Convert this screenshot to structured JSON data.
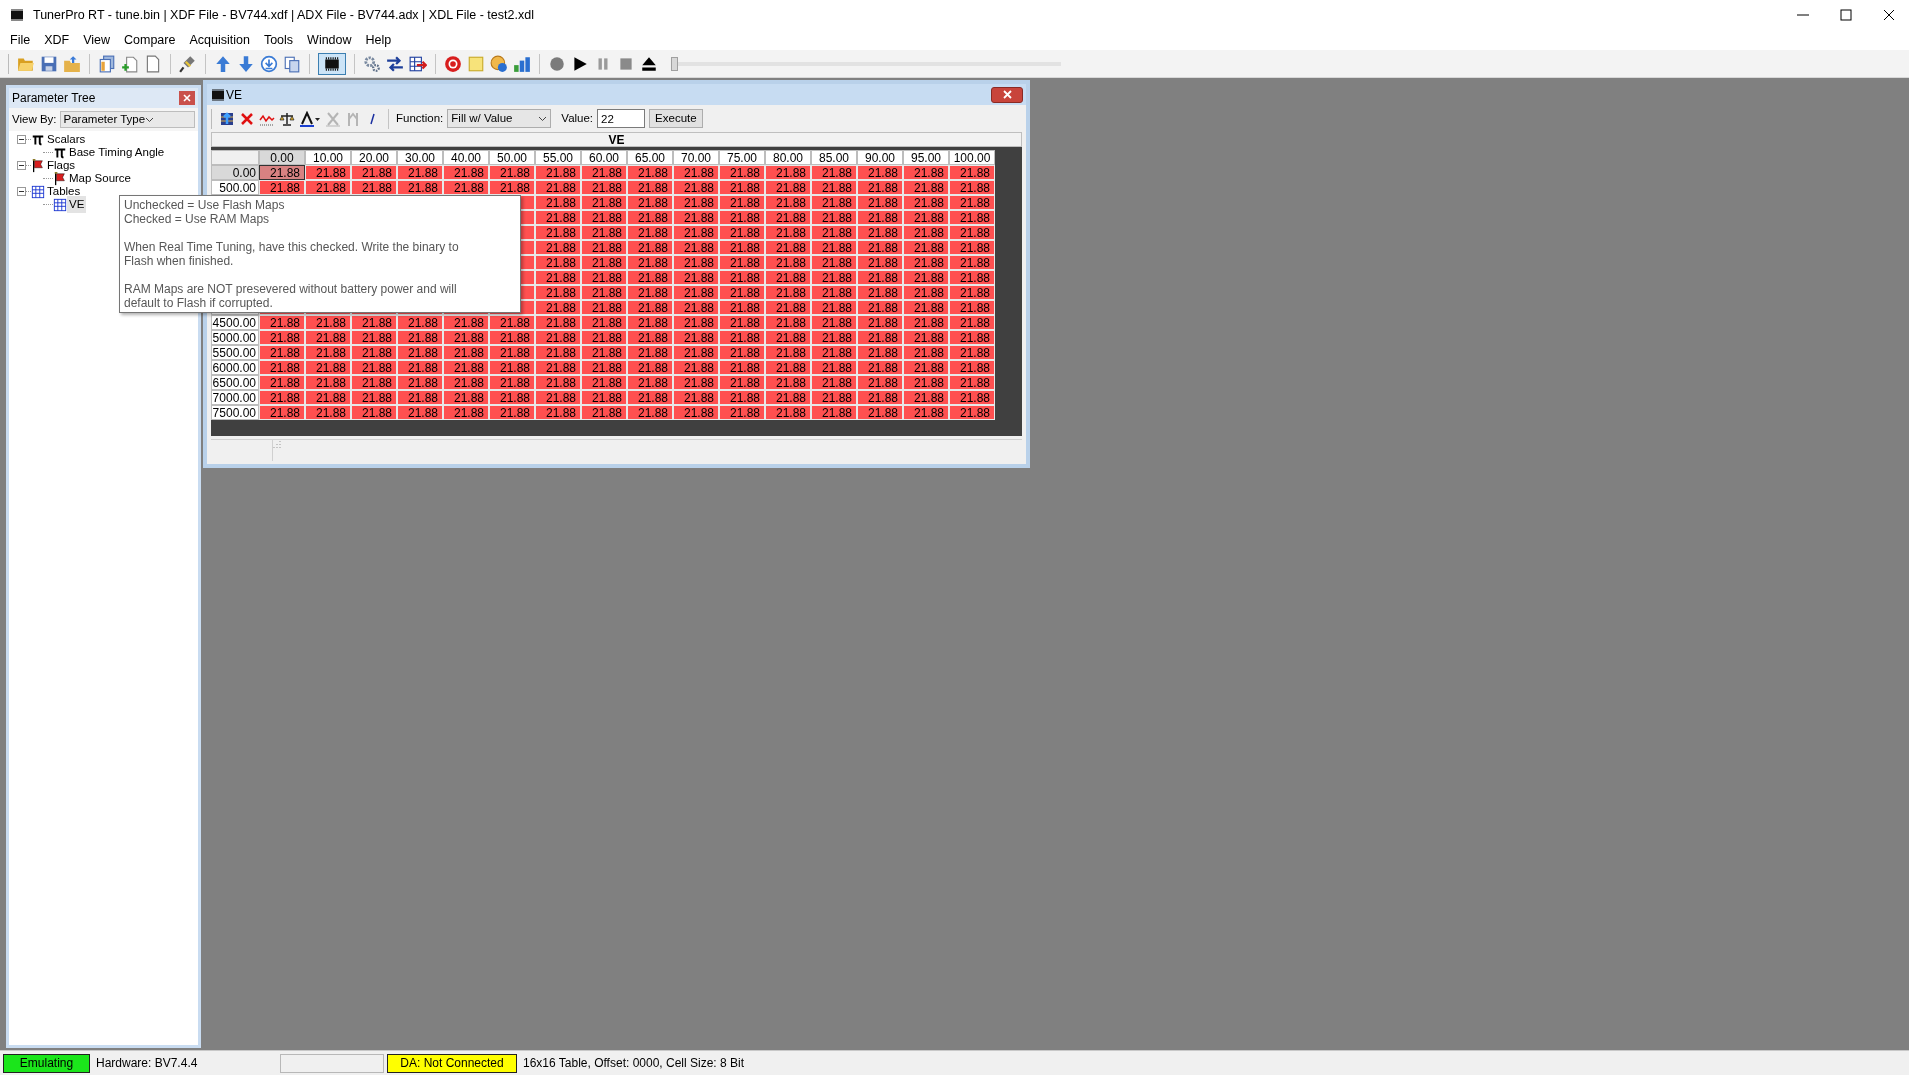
{
  "window": {
    "title": "TunerPro RT - tune.bin | XDF File - BV744.xdf | ADX File - BV744.adx | XDL File - test2.xdl"
  },
  "menu": [
    "File",
    "XDF",
    "View",
    "Compare",
    "Acquisition",
    "Tools",
    "Window",
    "Help"
  ],
  "toolbar": {
    "emulator_button": {
      "pressed": true
    },
    "playback_slider": {
      "level": 0
    }
  },
  "parameter_tree": {
    "title": "Parameter Tree",
    "view_by_label": "View By:",
    "view_by": "Parameter Type",
    "items": [
      {
        "label": "Scalars",
        "kind": "scalar",
        "expanded": true,
        "selected": false,
        "children": [
          {
            "label": "Base Timing Angle",
            "kind": "scalar",
            "selected": false
          }
        ]
      },
      {
        "label": "Flags",
        "kind": "flag",
        "expanded": true,
        "selected": false,
        "children": [
          {
            "label": "Map Source",
            "kind": "flag",
            "selected": false
          }
        ]
      },
      {
        "label": "Tables",
        "kind": "table",
        "expanded": true,
        "selected": false,
        "children": [
          {
            "label": "VE",
            "kind": "table",
            "selected": true
          }
        ]
      }
    ]
  },
  "tooltip": {
    "paragraphs": [
      [
        "Unchecked = Use Flash Maps",
        "Checked = Use RAM Maps"
      ],
      [
        "When Real Time Tuning, have this checked. Write the binary to Flash when finished."
      ],
      [
        "RAM Maps are NOT presevered without battery power and will default to Flash if corrupted."
      ]
    ]
  },
  "table_window": {
    "title": "VE",
    "function_label": "Function:",
    "function": "Fill w/ Value",
    "value_label": "Value:",
    "value": "22",
    "execute_button": "Execute",
    "table_title": "VE",
    "columns": [
      "0.00",
      "10.00",
      "20.00",
      "30.00",
      "40.00",
      "50.00",
      "55.00",
      "60.00",
      "65.00",
      "70.00",
      "75.00",
      "80.00",
      "85.00",
      "90.00",
      "95.00",
      "100.00"
    ],
    "rows": [
      {
        "label": "0.00",
        "cells": [
          {
            "value": "21.88",
            "selected": true
          },
          {
            "value": "21.88",
            "selected": false
          },
          {
            "value": "21.88",
            "selected": false
          },
          {
            "value": "21.88",
            "selected": false
          },
          {
            "value": "21.88",
            "selected": false
          },
          {
            "value": "21.88",
            "selected": false
          },
          {
            "value": "21.88",
            "selected": false
          },
          {
            "value": "21.88",
            "selected": false
          },
          {
            "value": "21.88",
            "selected": false
          },
          {
            "value": "21.88",
            "selected": false
          },
          {
            "value": "21.88",
            "selected": false
          },
          {
            "value": "21.88",
            "selected": false
          },
          {
            "value": "21.88",
            "selected": false
          },
          {
            "value": "21.88",
            "selected": false
          },
          {
            "value": "21.88",
            "selected": false
          },
          {
            "value": "21.88",
            "selected": false
          }
        ]
      },
      {
        "label": "500.00",
        "cells": [
          {
            "value": "21.88",
            "selected": false
          },
          {
            "value": "21.88",
            "selected": false
          },
          {
            "value": "21.88",
            "selected": false
          },
          {
            "value": "21.88",
            "selected": false
          },
          {
            "value": "21.88",
            "selected": false
          },
          {
            "value": "21.88",
            "selected": false
          },
          {
            "value": "21.88",
            "selected": false
          },
          {
            "value": "21.88",
            "selected": false
          },
          {
            "value": "21.88",
            "selected": false
          },
          {
            "value": "21.88",
            "selected": false
          },
          {
            "value": "21.88",
            "selected": false
          },
          {
            "value": "21.88",
            "selected": false
          },
          {
            "value": "21.88",
            "selected": false
          },
          {
            "value": "21.88",
            "selected": false
          },
          {
            "value": "21.88",
            "selected": false
          },
          {
            "value": "21.88",
            "selected": false
          }
        ]
      },
      {
        "cells": [
          {
            "value": "21.88",
            "selected": false
          },
          {
            "value": "21.88",
            "selected": false
          },
          {
            "value": "21.88",
            "selected": false
          },
          {
            "value": "21.88",
            "selected": false
          },
          {
            "value": "21.88",
            "selected": false
          },
          {
            "value": "21.88",
            "selected": false
          },
          {
            "value": "21.88",
            "selected": false
          },
          {
            "value": "21.88",
            "selected": false
          },
          {
            "value": "21.88",
            "selected": false
          },
          {
            "value": "21.88",
            "selected": false
          }
        ]
      },
      {
        "cells": [
          {
            "value": "21.88",
            "selected": false
          },
          {
            "value": "21.88",
            "selected": false
          },
          {
            "value": "21.88",
            "selected": false
          },
          {
            "value": "21.88",
            "selected": false
          },
          {
            "value": "21.88",
            "selected": false
          },
          {
            "value": "21.88",
            "selected": false
          },
          {
            "value": "21.88",
            "selected": false
          },
          {
            "value": "21.88",
            "selected": false
          },
          {
            "value": "21.88",
            "selected": false
          },
          {
            "value": "21.88",
            "selected": false
          }
        ]
      },
      {
        "cells": [
          {
            "value": "21.88",
            "selected": false
          },
          {
            "value": "21.88",
            "selected": false
          },
          {
            "value": "21.88",
            "selected": false
          },
          {
            "value": "21.88",
            "selected": false
          },
          {
            "value": "21.88",
            "selected": false
          },
          {
            "value": "21.88",
            "selected": false
          },
          {
            "value": "21.88",
            "selected": false
          },
          {
            "value": "21.88",
            "selected": false
          },
          {
            "value": "21.88",
            "selected": false
          },
          {
            "value": "21.88",
            "selected": false
          }
        ]
      },
      {
        "cells": [
          {
            "value": "21.88",
            "selected": false
          },
          {
            "value": "21.88",
            "selected": false
          },
          {
            "value": "21.88",
            "selected": false
          },
          {
            "value": "21.88",
            "selected": false
          },
          {
            "value": "21.88",
            "selected": false
          },
          {
            "value": "21.88",
            "selected": false
          },
          {
            "value": "21.88",
            "selected": false
          },
          {
            "value": "21.88",
            "selected": false
          },
          {
            "value": "21.88",
            "selected": false
          },
          {
            "value": "21.88",
            "selected": false
          }
        ]
      },
      {
        "cells": [
          {
            "value": "21.88",
            "selected": false
          },
          {
            "value": "21.88",
            "selected": false
          },
          {
            "value": "21.88",
            "selected": false
          },
          {
            "value": "21.88",
            "selected": false
          },
          {
            "value": "21.88",
            "selected": false
          },
          {
            "value": "21.88",
            "selected": false
          },
          {
            "value": "21.88",
            "selected": false
          },
          {
            "value": "21.88",
            "selected": false
          },
          {
            "value": "21.88",
            "selected": false
          },
          {
            "value": "21.88",
            "selected": false
          }
        ]
      },
      {
        "cells": [
          {
            "value": "21.88",
            "selected": false
          },
          {
            "value": "21.88",
            "selected": false
          },
          {
            "value": "21.88",
            "selected": false
          },
          {
            "value": "21.88",
            "selected": false
          },
          {
            "value": "21.88",
            "selected": false
          },
          {
            "value": "21.88",
            "selected": false
          },
          {
            "value": "21.88",
            "selected": false
          },
          {
            "value": "21.88",
            "selected": false
          },
          {
            "value": "21.88",
            "selected": false
          },
          {
            "value": "21.88",
            "selected": false
          }
        ]
      },
      {
        "cells": [
          {
            "value": "21.88",
            "selected": false
          },
          {
            "value": "21.88",
            "selected": false
          },
          {
            "value": "21.88",
            "selected": false
          },
          {
            "value": "21.88",
            "selected": false
          },
          {
            "value": "21.88",
            "selected": false
          },
          {
            "value": "21.88",
            "selected": false
          },
          {
            "value": "21.88",
            "selected": false
          },
          {
            "value": "21.88",
            "selected": false
          },
          {
            "value": "21.88",
            "selected": false
          },
          {
            "value": "21.88",
            "selected": false
          }
        ]
      },
      {
        "cells": [
          {
            "value": "21.88",
            "selected": false
          },
          {
            "value": "21.88",
            "selected": false
          },
          {
            "value": "21.88",
            "selected": false
          },
          {
            "value": "21.88",
            "selected": false
          },
          {
            "value": "21.88",
            "selected": false
          },
          {
            "value": "21.88",
            "selected": false
          },
          {
            "value": "21.88",
            "selected": false
          },
          {
            "value": "21.88",
            "selected": false
          },
          {
            "value": "21.88",
            "selected": false
          },
          {
            "value": "21.88",
            "selected": false
          }
        ]
      },
      {
        "label": "4500.00",
        "cells": [
          {
            "value": "21.88",
            "selected": false
          },
          {
            "value": "21.88",
            "selected": false
          },
          {
            "value": "21.88",
            "selected": false
          },
          {
            "value": "21.88",
            "selected": false
          },
          {
            "value": "21.88",
            "selected": false
          },
          {
            "value": "21.88",
            "selected": false
          },
          {
            "value": "21.88",
            "selected": false
          },
          {
            "value": "21.88",
            "selected": false
          },
          {
            "value": "21.88",
            "selected": false
          },
          {
            "value": "21.88",
            "selected": false
          },
          {
            "value": "21.88",
            "selected": false
          },
          {
            "value": "21.88",
            "selected": false
          },
          {
            "value": "21.88",
            "selected": false
          },
          {
            "value": "21.88",
            "selected": false
          },
          {
            "value": "21.88",
            "selected": false
          },
          {
            "value": "21.88",
            "selected": false
          }
        ]
      },
      {
        "label": "5000.00",
        "cells": [
          {
            "value": "21.88",
            "selected": false
          },
          {
            "value": "21.88",
            "selected": false
          },
          {
            "value": "21.88",
            "selected": false
          },
          {
            "value": "21.88",
            "selected": false
          },
          {
            "value": "21.88",
            "selected": false
          },
          {
            "value": "21.88",
            "selected": false
          },
          {
            "value": "21.88",
            "selected": false
          },
          {
            "value": "21.88",
            "selected": false
          },
          {
            "value": "21.88",
            "selected": false
          },
          {
            "value": "21.88",
            "selected": false
          },
          {
            "value": "21.88",
            "selected": false
          },
          {
            "value": "21.88",
            "selected": false
          },
          {
            "value": "21.88",
            "selected": false
          },
          {
            "value": "21.88",
            "selected": false
          },
          {
            "value": "21.88",
            "selected": false
          },
          {
            "value": "21.88",
            "selected": false
          }
        ]
      },
      {
        "label": "5500.00",
        "cells": [
          {
            "value": "21.88",
            "selected": false
          },
          {
            "value": "21.88",
            "selected": false
          },
          {
            "value": "21.88",
            "selected": false
          },
          {
            "value": "21.88",
            "selected": false
          },
          {
            "value": "21.88",
            "selected": false
          },
          {
            "value": "21.88",
            "selected": false
          },
          {
            "value": "21.88",
            "selected": false
          },
          {
            "value": "21.88",
            "selected": false
          },
          {
            "value": "21.88",
            "selected": false
          },
          {
            "value": "21.88",
            "selected": false
          },
          {
            "value": "21.88",
            "selected": false
          },
          {
            "value": "21.88",
            "selected": false
          },
          {
            "value": "21.88",
            "selected": false
          },
          {
            "value": "21.88",
            "selected": false
          },
          {
            "value": "21.88",
            "selected": false
          },
          {
            "value": "21.88",
            "selected": false
          }
        ]
      },
      {
        "label": "6000.00",
        "cells": [
          {
            "value": "21.88",
            "selected": false
          },
          {
            "value": "21.88",
            "selected": false
          },
          {
            "value": "21.88",
            "selected": false
          },
          {
            "value": "21.88",
            "selected": false
          },
          {
            "value": "21.88",
            "selected": false
          },
          {
            "value": "21.88",
            "selected": false
          },
          {
            "value": "21.88",
            "selected": false
          },
          {
            "value": "21.88",
            "selected": false
          },
          {
            "value": "21.88",
            "selected": false
          },
          {
            "value": "21.88",
            "selected": false
          },
          {
            "value": "21.88",
            "selected": false
          },
          {
            "value": "21.88",
            "selected": false
          },
          {
            "value": "21.88",
            "selected": false
          },
          {
            "value": "21.88",
            "selected": false
          },
          {
            "value": "21.88",
            "selected": false
          },
          {
            "value": "21.88",
            "selected": false
          }
        ]
      },
      {
        "label": "6500.00",
        "cells": [
          {
            "value": "21.88",
            "selected": false
          },
          {
            "value": "21.88",
            "selected": false
          },
          {
            "value": "21.88",
            "selected": false
          },
          {
            "value": "21.88",
            "selected": false
          },
          {
            "value": "21.88",
            "selected": false
          },
          {
            "value": "21.88",
            "selected": false
          },
          {
            "value": "21.88",
            "selected": false
          },
          {
            "value": "21.88",
            "selected": false
          },
          {
            "value": "21.88",
            "selected": false
          },
          {
            "value": "21.88",
            "selected": false
          },
          {
            "value": "21.88",
            "selected": false
          },
          {
            "value": "21.88",
            "selected": false
          },
          {
            "value": "21.88",
            "selected": false
          },
          {
            "value": "21.88",
            "selected": false
          },
          {
            "value": "21.88",
            "selected": false
          },
          {
            "value": "21.88",
            "selected": false
          }
        ]
      },
      {
        "label": "7000.00",
        "cells": [
          {
            "value": "21.88",
            "selected": false
          },
          {
            "value": "21.88",
            "selected": false
          },
          {
            "value": "21.88",
            "selected": false
          },
          {
            "value": "21.88",
            "selected": false
          },
          {
            "value": "21.88",
            "selected": false
          },
          {
            "value": "21.88",
            "selected": false
          },
          {
            "value": "21.88",
            "selected": false
          },
          {
            "value": "21.88",
            "selected": false
          },
          {
            "value": "21.88",
            "selected": false
          },
          {
            "value": "21.88",
            "selected": false
          },
          {
            "value": "21.88",
            "selected": false
          },
          {
            "value": "21.88",
            "selected": false
          },
          {
            "value": "21.88",
            "selected": false
          },
          {
            "value": "21.88",
            "selected": false
          },
          {
            "value": "21.88",
            "selected": false
          },
          {
            "value": "21.88",
            "selected": false
          }
        ]
      },
      {
        "label": "7500.00",
        "cells": [
          {
            "value": "21.88",
            "selected": false
          },
          {
            "value": "21.88",
            "selected": false
          },
          {
            "value": "21.88",
            "selected": false
          },
          {
            "value": "21.88",
            "selected": false
          },
          {
            "value": "21.88",
            "selected": false
          },
          {
            "value": "21.88",
            "selected": false
          },
          {
            "value": "21.88",
            "selected": false
          },
          {
            "value": "21.88",
            "selected": false
          },
          {
            "value": "21.88",
            "selected": false
          },
          {
            "value": "21.88",
            "selected": false
          },
          {
            "value": "21.88",
            "selected": false
          },
          {
            "value": "21.88",
            "selected": false
          },
          {
            "value": "21.88",
            "selected": false
          },
          {
            "value": "21.88",
            "selected": false
          },
          {
            "value": "21.88",
            "selected": false
          },
          {
            "value": "21.88",
            "selected": false
          }
        ]
      }
    ]
  },
  "status_bar": [
    {
      "kind": "indicator",
      "text": "Emulating",
      "color": "#1be51b"
    },
    {
      "kind": "text",
      "text": "Hardware: BV7.4.4"
    },
    {
      "kind": "blank"
    },
    {
      "kind": "indicator",
      "text": "DA: Not Connected",
      "color": "#ffff00"
    },
    {
      "kind": "text",
      "text": "16x16 Table, Offset: 0000,  Cell Size: 8 Bit"
    }
  ]
}
